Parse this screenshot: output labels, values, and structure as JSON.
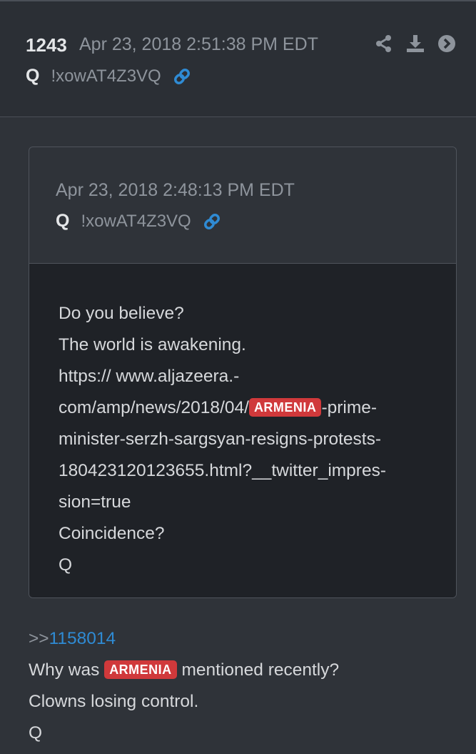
{
  "post": {
    "number": "1243",
    "date": "Apr 23, 2018 2:51:38 PM EDT",
    "author": "Q",
    "trip": "!xowAT4Z3VQ",
    "actions": [
      "share-icon",
      "download-icon",
      "forward-icon"
    ]
  },
  "quoted": {
    "date": "Apr 23, 2018 2:48:13 PM EDT",
    "author": "Q",
    "trip": "!xowAT4Z3VQ",
    "lines": [
      "Do you believe?",
      "The world is awakening.",
      "https:// www.aljazeera.-",
      "com/amp/news/2018/04/",
      "ARMENIA",
      "-prime-",
      "minister-serzh-sargsyan-resigns-protests-",
      "180423120123655.html?__twitter_impres-",
      "sion=true",
      "Coincidence?",
      "Q"
    ]
  },
  "reply": {
    "prefix": ">>",
    "ref": "1158014",
    "line1_before": "Why was ",
    "tag": "ARMENIA",
    "line1_after": " mentioned recently?",
    "line2": "Clowns losing control.",
    "line3": "Q"
  },
  "colors": {
    "background": "#2f3339",
    "tag": "#d0393b",
    "link": "#2f8bd4"
  }
}
